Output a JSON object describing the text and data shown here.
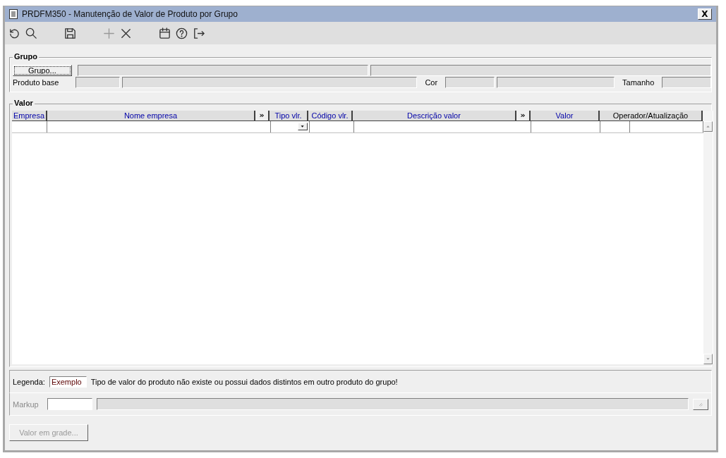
{
  "window": {
    "title": "PRDFM350 - Manutenção de Valor de Produto por Grupo",
    "close_label": "X"
  },
  "toolbar": [
    {
      "kind": "undo",
      "disabled": false
    },
    {
      "kind": "search",
      "disabled": false
    },
    {
      "kind": "gap"
    },
    {
      "kind": "save",
      "disabled": false
    },
    {
      "kind": "gap"
    },
    {
      "kind": "add",
      "disabled": true
    },
    {
      "kind": "delete",
      "disabled": false
    },
    {
      "kind": "gap"
    },
    {
      "kind": "calendar",
      "disabled": false
    },
    {
      "kind": "help",
      "disabled": false
    },
    {
      "kind": "exit",
      "disabled": false
    }
  ],
  "grupo": {
    "title": "Grupo",
    "button": "Grupo...",
    "produto_base_label": "Produto base",
    "cor_label": "Cor",
    "tamanho_label": "Tamanho"
  },
  "valor": {
    "title": "Valor",
    "columns": [
      {
        "label": "Empresa",
        "kind": "column",
        "editable": true
      },
      {
        "label": "Nome empresa",
        "kind": "column",
        "editable": true
      },
      {
        "label": "»",
        "kind": "expander"
      },
      {
        "label": "Tipo vlr.",
        "kind": "column",
        "editable": true
      },
      {
        "label": "Código vlr.",
        "kind": "column",
        "editable": true
      },
      {
        "label": "Descrição valor",
        "kind": "column",
        "editable": true
      },
      {
        "label": "»",
        "kind": "expander"
      },
      {
        "label": "Valor",
        "kind": "column",
        "editable": true
      },
      {
        "label": "Operador/Atualização",
        "kind": "column",
        "editable": false
      }
    ]
  },
  "legenda": {
    "label": "Legenda:",
    "sample": "Exemplo",
    "text": "Tipo de valor do produto não existe ou possui dados distintos em outro produto do grupo!"
  },
  "markup": {
    "label": "Markup",
    "disabled": true
  },
  "buttons": [
    {
      "label": "Valor em grade...",
      "disabled": true
    }
  ]
}
